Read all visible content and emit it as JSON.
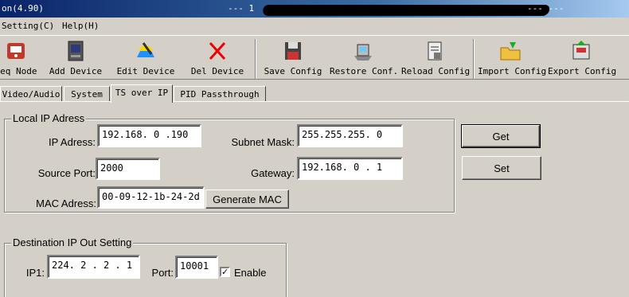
{
  "window": {
    "title_left": "on(4.90)",
    "title_mid": "--- 1",
    "title_right": "--- ---"
  },
  "menu": {
    "items": [
      "Setting(C)",
      "Help(H)"
    ]
  },
  "toolbar": {
    "items": [
      {
        "label": "req Node",
        "icon": "freq-node-icon"
      },
      {
        "label": "Add Device",
        "icon": "add-device-icon"
      },
      {
        "label": "Edit Device",
        "icon": "edit-device-icon"
      },
      {
        "label": "Del Device",
        "icon": "delete-icon"
      },
      {
        "label": "Save Config",
        "icon": "save-icon"
      },
      {
        "label": "Restore Conf.",
        "icon": "restore-icon"
      },
      {
        "label": "Reload Config",
        "icon": "reload-icon"
      },
      {
        "label": "Import Config",
        "icon": "import-icon"
      },
      {
        "label": "Export Config",
        "icon": "export-icon"
      }
    ]
  },
  "tabs": [
    "Video/Audio",
    "System",
    "TS over IP",
    "PID Passthrough"
  ],
  "active_tab": "TS over IP",
  "local_ip": {
    "title": "Local IP Adress",
    "ip_label": "IP Adress:",
    "ip_value": "192.168. 0 .190",
    "mask_label": "Subnet Mask:",
    "mask_value": "255.255.255. 0",
    "port_label": "Source Port:",
    "port_value": "2000",
    "gateway_label": "Gateway:",
    "gateway_value": "192.168. 0 . 1",
    "mac_label": "MAC Adress:",
    "mac_value": "00-09-12-1b-24-2d",
    "generate_mac": "Generate MAC"
  },
  "actions": {
    "get": "Get",
    "set": "Set"
  },
  "destination": {
    "title": "Destination IP Out Setting",
    "ip1_label": "IP1:",
    "ip1_value": "224. 2 . 2 . 1",
    "port_label": "Port:",
    "port_value": "10001",
    "enable_label": "Enable",
    "enable_checked": true,
    "check_mark": "✓"
  },
  "colors": {
    "titlebar_start": "#0a246a",
    "face": "#d4d0c8"
  }
}
